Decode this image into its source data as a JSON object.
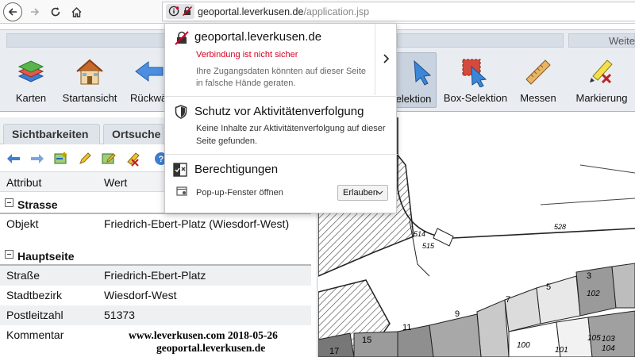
{
  "browser": {
    "url_host": "geoportal.leverkusen.de",
    "url_path": "/application.jsp"
  },
  "popup": {
    "site": "geoportal.leverkusen.de",
    "insecure": "Verbindung ist nicht sicher",
    "insecure_detail_1": "Ihre Zugangsdaten könnten auf dieser Seite",
    "insecure_detail_2": "in falsche Hände geraten.",
    "tracking_title": "Schutz vor Aktivitätenverfolgung",
    "tracking_detail_1": "Keine Inhalte zur Aktivitätenverfolgung auf dieser",
    "tracking_detail_2": "Seite gefunden.",
    "perm_title": "Berechtigungen",
    "perm_item": "Pop-up-Fenster öffnen",
    "perm_value": "Erlauben"
  },
  "toolbar": {
    "group_right_head": "Weite",
    "tools": {
      "karten": "Karten",
      "startansicht": "Startansicht",
      "rueck": "Rückwä",
      "selektion": "elektion",
      "box": "Box-Selektion",
      "messen": "Messen",
      "markierung": "Markierung"
    }
  },
  "tabs": {
    "sichtbarkeiten": "Sichtbarkeiten",
    "ortsuche": "Ortsuche"
  },
  "grid": {
    "col_attr": "Attribut",
    "col_value": "Wert",
    "sections": [
      {
        "title": "Strasse",
        "rows": [
          {
            "attr": "Objekt",
            "value": "Friedrich-Ebert-Platz (Wiesdorf-West)"
          }
        ]
      },
      {
        "title": "Hauptseite",
        "rows": [
          {
            "attr": "Straße",
            "value": "Friedrich-Ebert-Platz"
          },
          {
            "attr": "Stadtbezirk",
            "value": "Wiesdorf-West"
          },
          {
            "attr": "Postleitzahl",
            "value": "51373"
          },
          {
            "attr": "Kommentar",
            "value": ""
          }
        ]
      }
    ]
  },
  "map": {
    "labels": [
      "514",
      "515",
      "528",
      "7",
      "5",
      "3",
      "102",
      "9",
      "11",
      "15",
      "17",
      "100",
      "101",
      "105",
      "103",
      "104"
    ]
  },
  "watermark": {
    "line1": "www.leverkusen.com  2018-05-26",
    "line2": "geoportal.leverkusen.de"
  }
}
